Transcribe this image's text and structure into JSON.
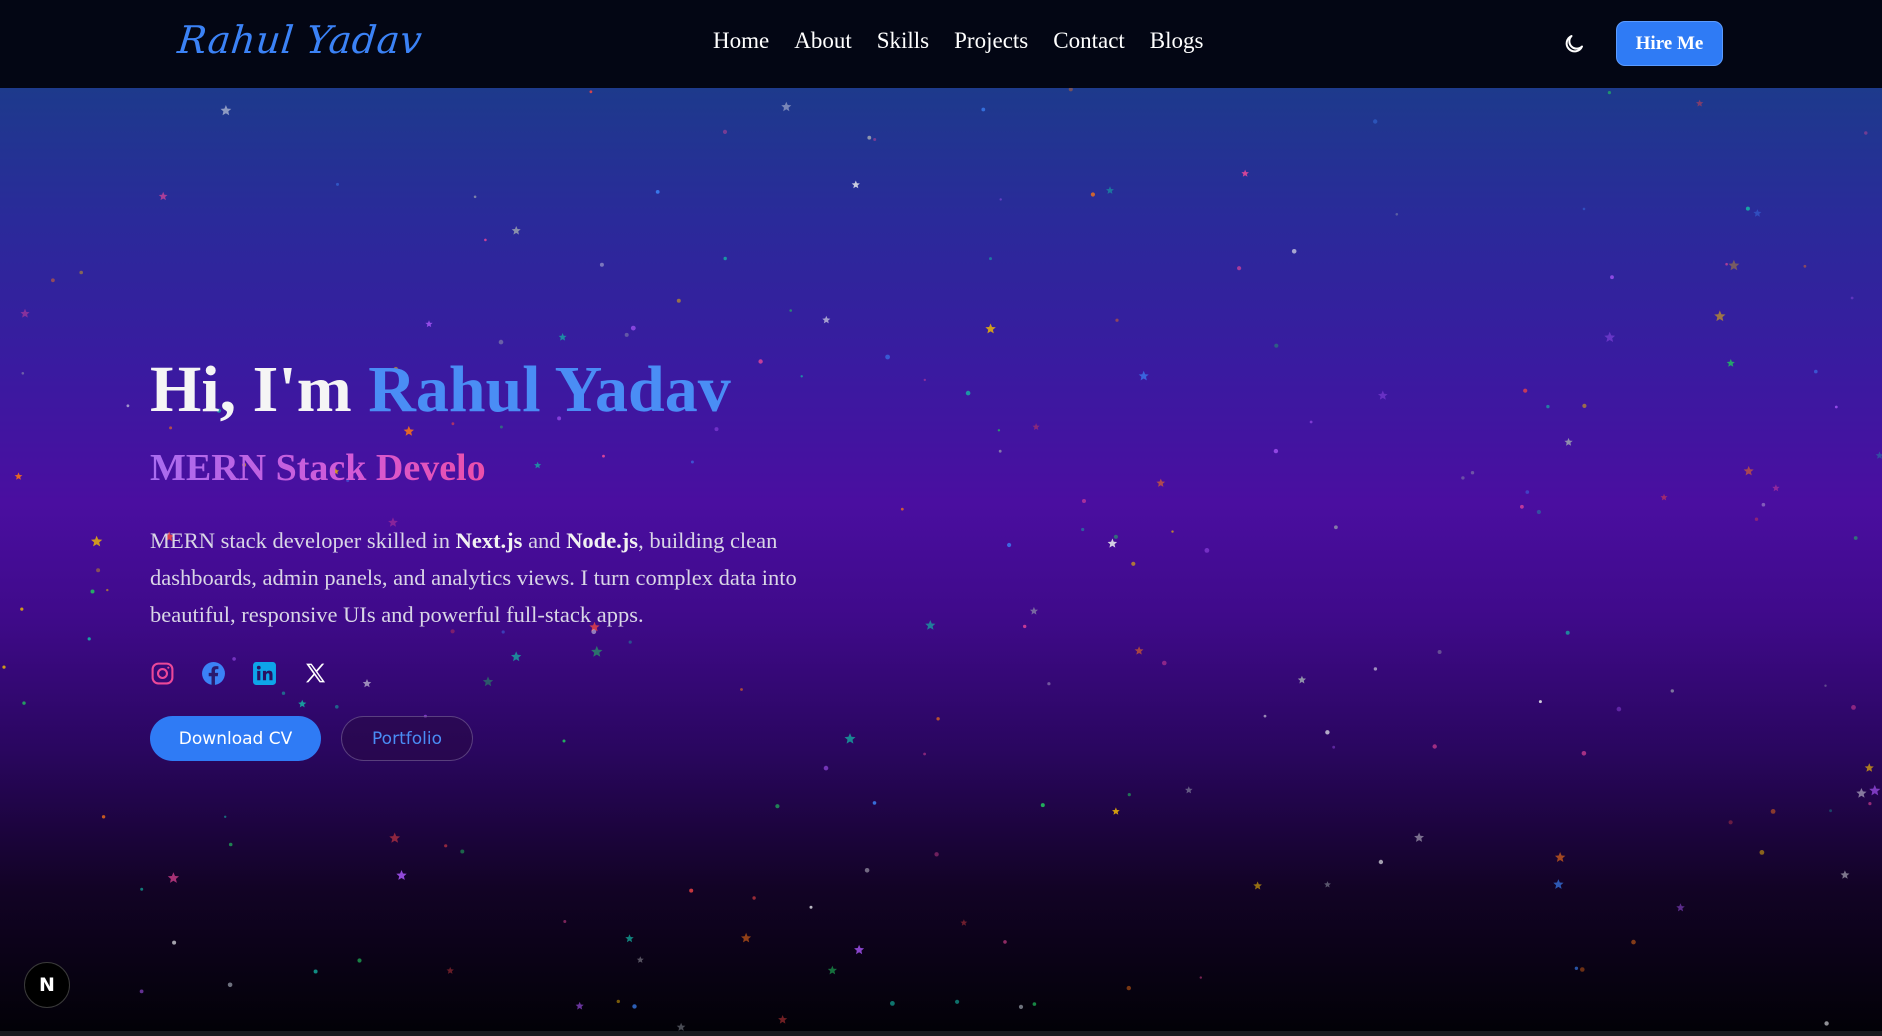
{
  "nav": {
    "logo": "Rahul Yadav",
    "links": [
      "Home",
      "About",
      "Skills",
      "Projects",
      "Contact",
      "Blogs"
    ],
    "theme_icon": "moon-icon",
    "hire_label": "Hire Me"
  },
  "hero": {
    "greeting_prefix": "Hi, I'm ",
    "name": "Rahul Yadav",
    "role": "MERN Stack Develo",
    "bio": {
      "part1": "MERN stack developer skilled in ",
      "bold1": "Next.js",
      "part2": " and ",
      "bold2": "Node.js",
      "part3": ", building clean dashboards, admin panels, and analytics views. I turn complex data into beautiful, responsive UIs and powerful full-stack apps."
    },
    "socials": [
      "instagram-icon",
      "facebook-icon",
      "linkedin-icon",
      "x-icon"
    ],
    "cv_label": "Download CV",
    "portfolio_label": "Portfolio"
  },
  "dev_badge": "N",
  "colors": {
    "accent": "#2f7bf5",
    "name": "#4a8df5",
    "instagram": "#ec4899",
    "facebook": "#3b82f6",
    "linkedin": "#0ea5e9"
  }
}
